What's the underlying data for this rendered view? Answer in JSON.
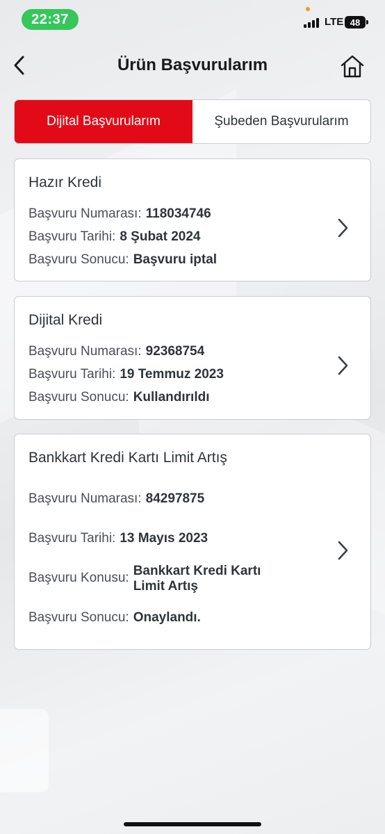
{
  "status_bar": {
    "time": "22:37",
    "network": "LTE",
    "battery": "48",
    "time_pill_color": "#35c759"
  },
  "header": {
    "title": "Ürün Başvurularım",
    "back_icon": "chevron-left-icon",
    "home_icon": "home-icon"
  },
  "tabs": [
    {
      "label": "Dijital Başvurularım",
      "active": true
    },
    {
      "label": "Şubeden Başvurularım",
      "active": false
    }
  ],
  "accent_color": "#e30a17",
  "applications": [
    {
      "title": "Hazır Kredi",
      "number_label": "Başvuru Numarası:",
      "number": "118034746",
      "date_label": "Başvuru Tarihi:",
      "date": "8 Şubat 2024",
      "result_label": "Başvuru Sonucu:",
      "result": "Başvuru iptal"
    },
    {
      "title": "Dijital Kredi",
      "number_label": "Başvuru Numarası:",
      "number": "92368754",
      "date_label": "Başvuru Tarihi:",
      "date": "19 Temmuz 2023",
      "result_label": "Başvuru Sonucu:",
      "result": "Kullandırıldı"
    },
    {
      "title": "Bankkart Kredi Kartı Limit Artış",
      "number_label": "Başvuru Numarası:",
      "number": "84297875",
      "date_label": "Başvuru Tarihi:",
      "date": "13 Mayıs 2023",
      "subject_label": "Başvuru Konusu:",
      "subject": "Bankkart Kredi Kartı Limit Artış",
      "result_label": "Başvuru Sonucu:",
      "result": "Onaylandı."
    }
  ]
}
